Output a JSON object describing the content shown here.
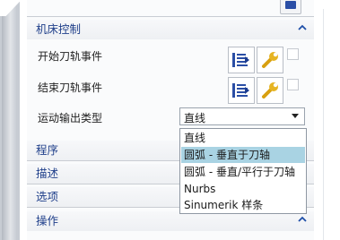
{
  "panel": {
    "section_machine": {
      "title": "机床控制",
      "chevron": "^"
    },
    "start_event_label": "开始刀轨事件",
    "end_event_label": "结束刀轨事件",
    "motion_type_label": "运动输出类型",
    "motion_type_value": "直线",
    "dropdown_options": [
      "直线",
      "圆弧 - 垂直于刀轴",
      "圆弧 - 垂直/平行于刀轴",
      "Nurbs",
      "Sinumerik 样条"
    ],
    "selected_option_index": 1,
    "sections": [
      {
        "title": "程序",
        "chevron": "v"
      },
      {
        "title": "描述",
        "chevron": "v"
      },
      {
        "title": "选项",
        "chevron": "v"
      },
      {
        "title": "操作",
        "chevron": "^"
      }
    ]
  },
  "colors": {
    "header_text": "#1f3f8a",
    "selection": "#a9d3e3"
  },
  "icons": [
    "tool-path-icon",
    "wrench-icon",
    "chevron-up-icon",
    "chevron-down-icon"
  ]
}
